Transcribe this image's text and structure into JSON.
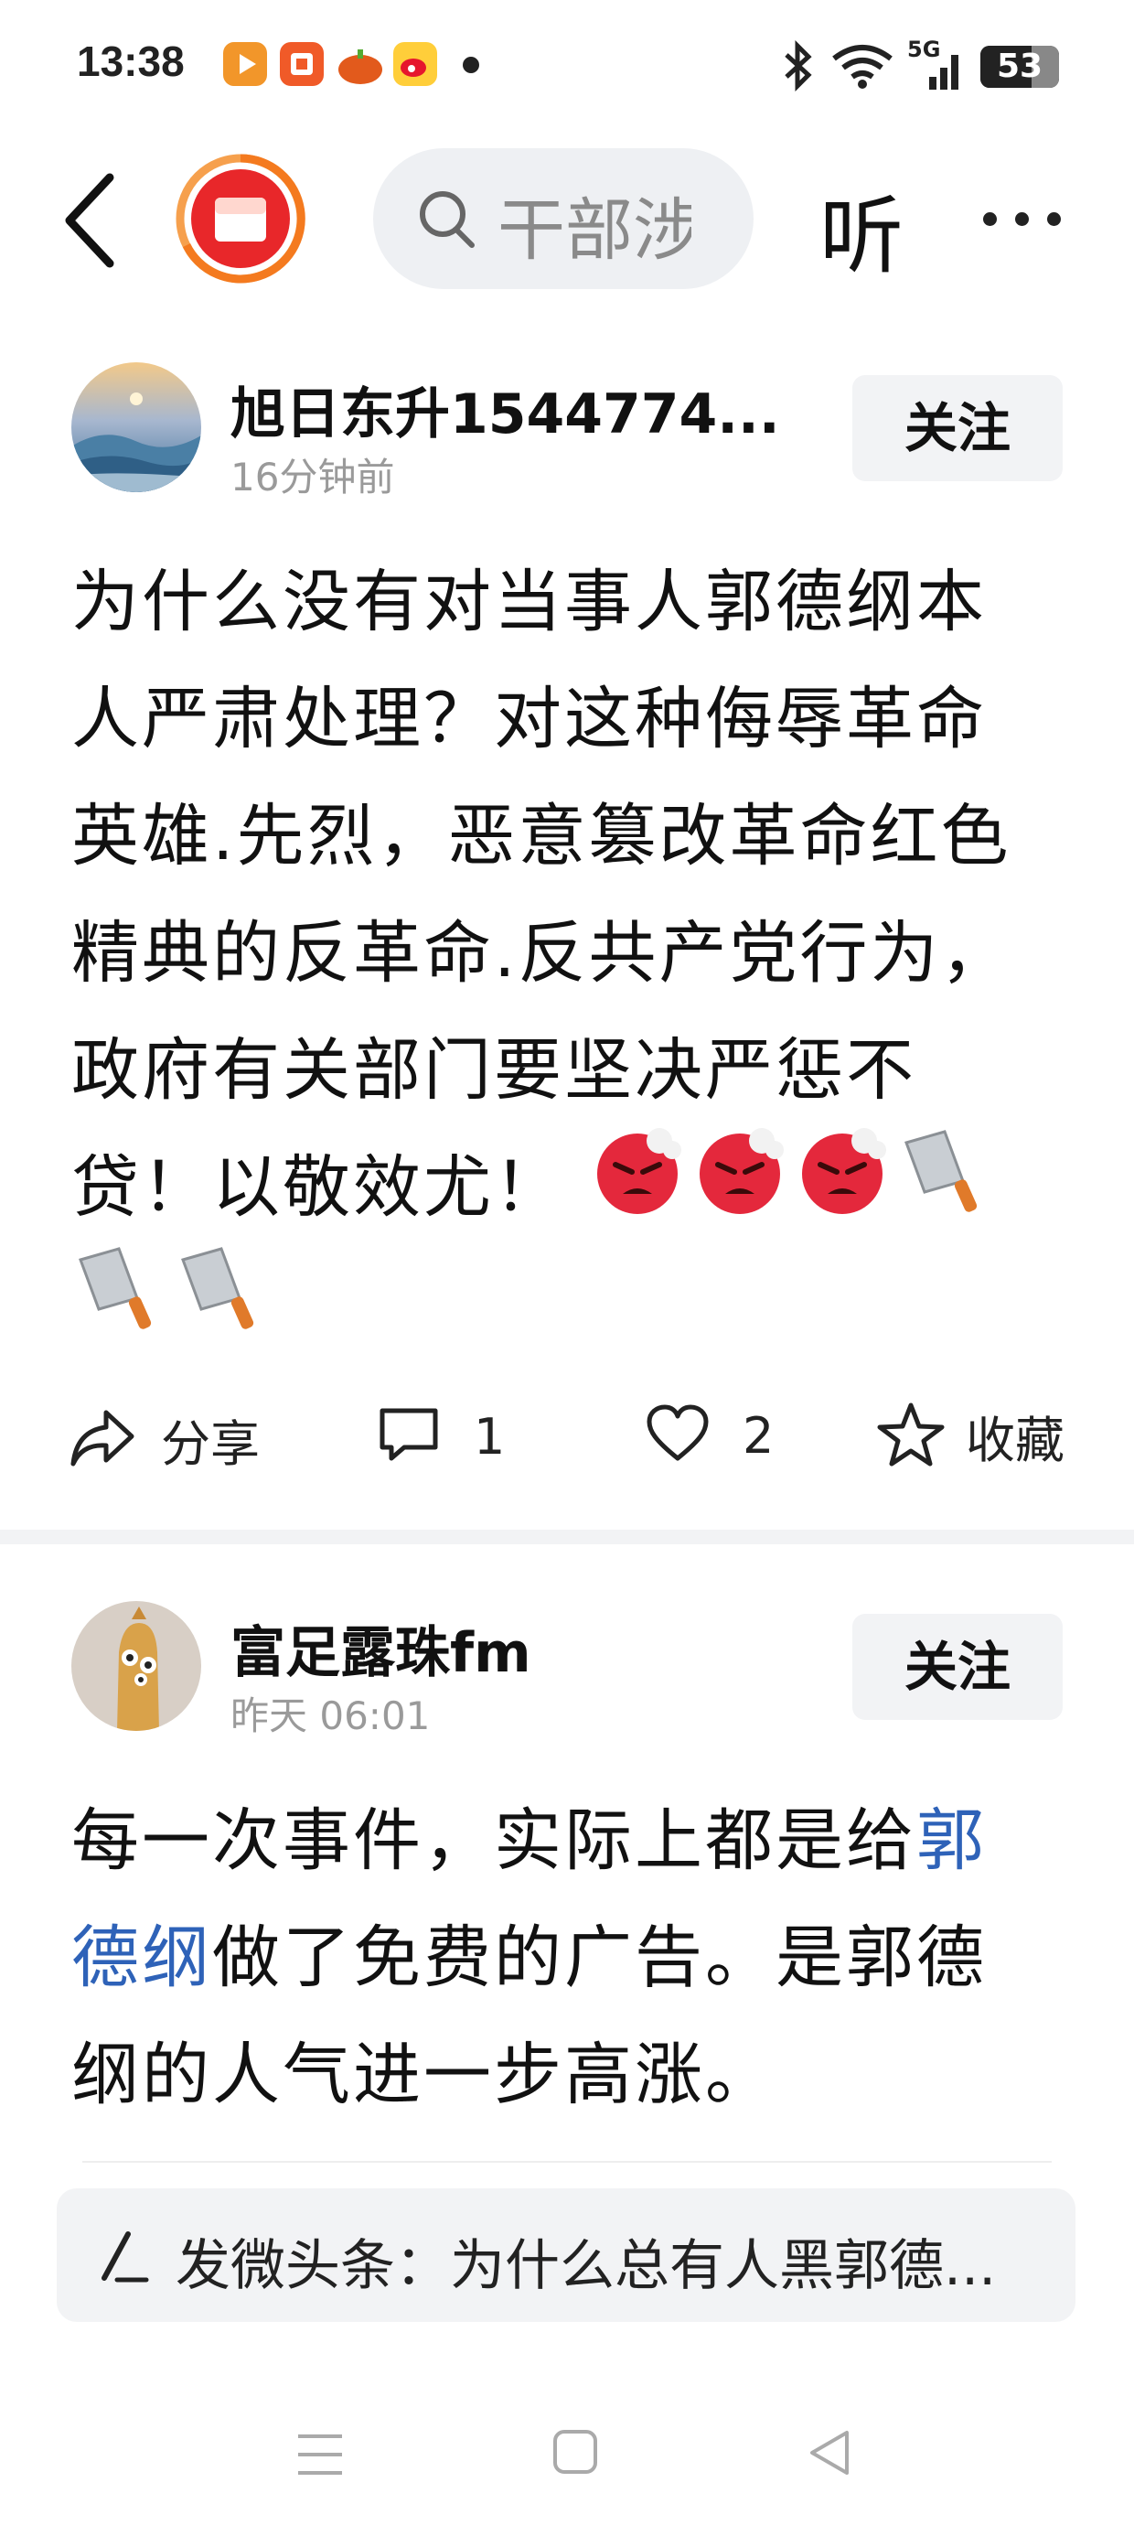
{
  "status_bar": {
    "time": "13:38",
    "network": "5G",
    "battery": "53",
    "app_icons": [
      "video-app-icon",
      "red-app-icon",
      "pumpkin-app-icon",
      "weibo-icon"
    ]
  },
  "top_nav": {
    "search_placeholder": "干部涉",
    "listen_label": "听"
  },
  "posts": [
    {
      "author": "旭日东升1544774...",
      "time": "16分钟前",
      "follow_label": "关注",
      "text_lines": [
        "为什么没有对当事人郭德纲本",
        "人严肃处理？对这种侮辱革命",
        "英雄.先烈，恶意篡改革命红色",
        "精典的反革命.反共产党行为，",
        "政府有关部门要坚决严惩不",
        "贷！以敬效尤！"
      ],
      "emojis": [
        "angry-face-icon",
        "angry-face-icon",
        "angry-face-icon",
        "cleaver-icon",
        "cleaver-icon",
        "cleaver-icon"
      ],
      "actions": {
        "share": "分享",
        "comments": "1",
        "likes": "2",
        "favorite": "收藏"
      }
    },
    {
      "author": "富足露珠fm",
      "time": "昨天  06:01",
      "follow_label": "关注",
      "line1_text": "每一次事件，实际上都是给",
      "line1_link": "郭",
      "line2_link": "德纲",
      "line2_text": "做了免费的广告。是郭德",
      "line3_text": "纲的人气进一步高涨。"
    }
  ],
  "compose": {
    "text": "发微头条：为什么总有人黑郭德..."
  },
  "colors": {
    "link": "#2e62b8",
    "accent_orange": "#f47a1f",
    "red": "#e8272a"
  }
}
